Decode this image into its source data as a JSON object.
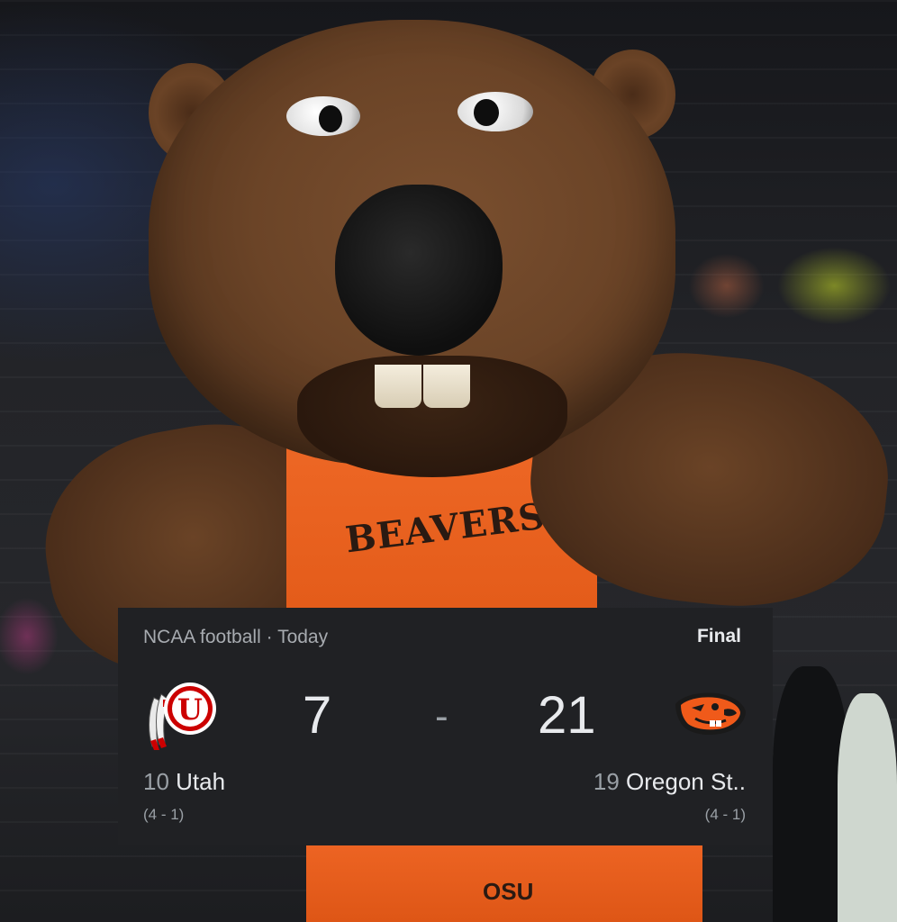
{
  "scorecard": {
    "league": "NCAA football",
    "separator": "·",
    "date": "Today",
    "status": "Final",
    "score_separator": "-",
    "home": {
      "rank": "10",
      "name": "Utah",
      "score": "7",
      "record": "(4 - 1)",
      "logo_icon": "utah-utes-logo-icon",
      "logo_text": "U",
      "color": "#cc0000"
    },
    "away": {
      "rank": "19",
      "name": "Oregon St..",
      "score": "21",
      "record": "(4 - 1)",
      "logo_icon": "oregon-state-beaver-logo-icon",
      "color": "#f05a1a"
    }
  },
  "photo": {
    "jersey_text": "BEAVERS",
    "shorts_text": "OSU"
  },
  "colors": {
    "card_background": "#202124",
    "primary_text": "#e8eaed",
    "secondary_text": "#9aa0a6"
  }
}
